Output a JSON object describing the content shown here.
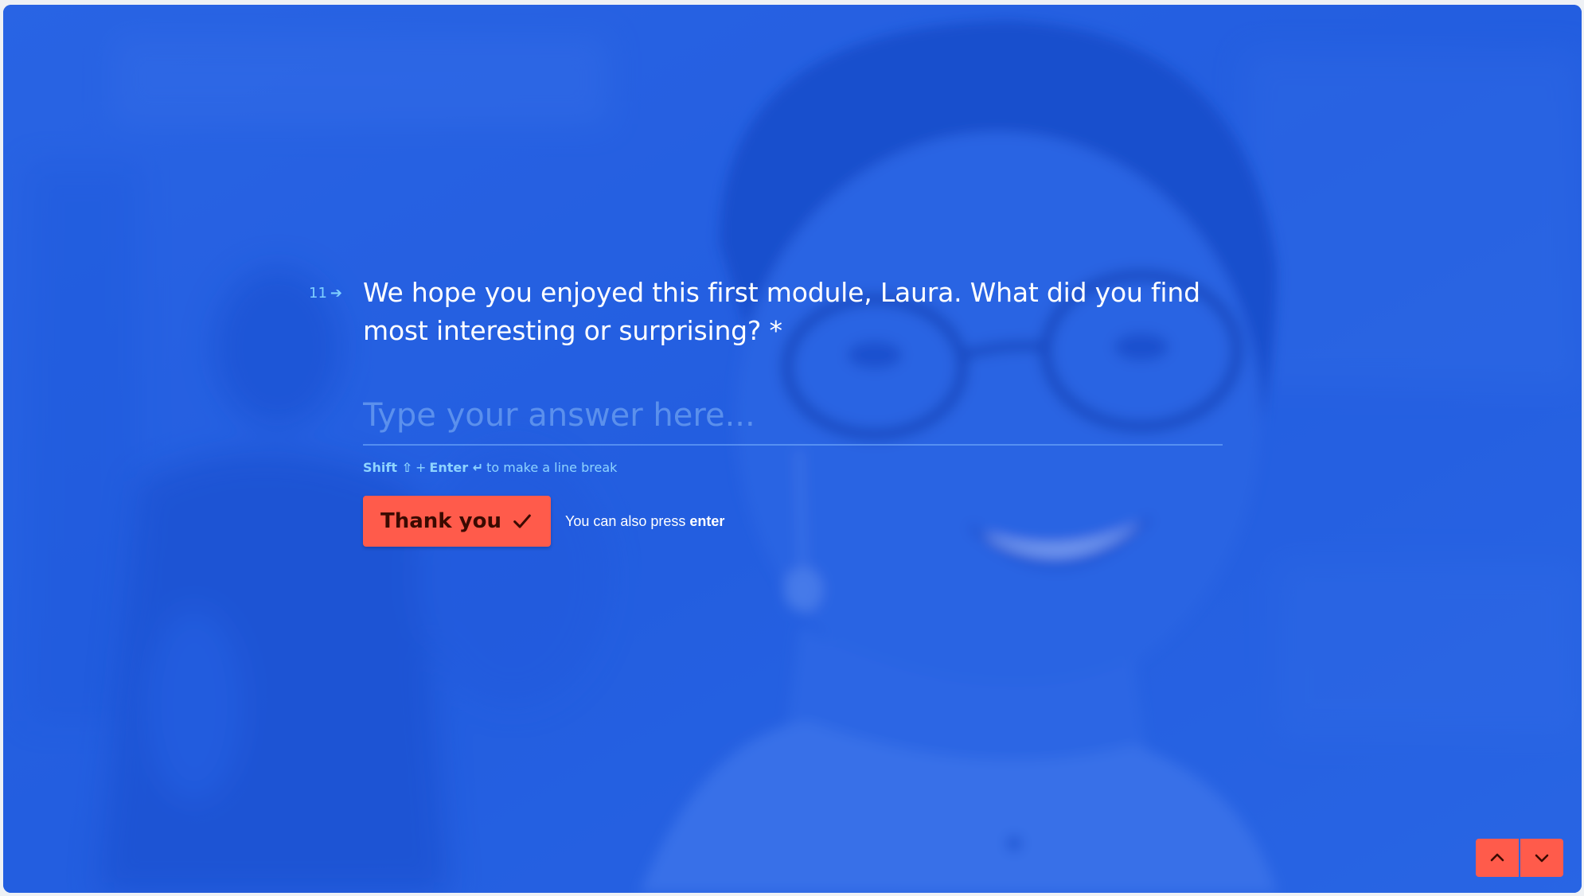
{
  "question": {
    "number": "11",
    "text": "We hope you enjoyed this first module, Laura. What did you find most interesting or surprising? *"
  },
  "answer": {
    "placeholder": "Type your answer here...",
    "value": ""
  },
  "hint": {
    "shift": "Shift ⇧",
    "plus": "+",
    "enter": "Enter ↵",
    "suffix": "to make a line break"
  },
  "submit": {
    "label": "Thank you",
    "icon": "check-icon"
  },
  "press_hint": {
    "prefix": "You can also press",
    "key": "enter"
  },
  "navigation": {
    "up_icon": "chevron-up-icon",
    "down_icon": "chevron-down-icon"
  },
  "colors": {
    "background_blue": "#2e68e0",
    "accent": "#ff5b4b",
    "question_text": "#ffffff",
    "hint": "#8ed4ff"
  }
}
